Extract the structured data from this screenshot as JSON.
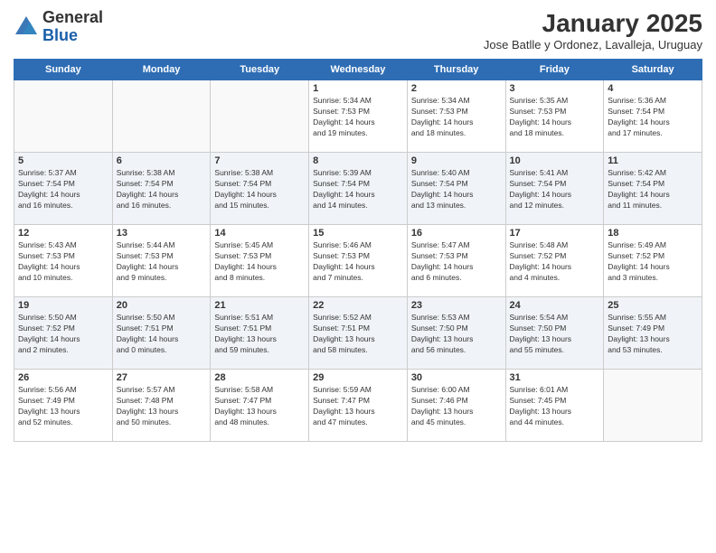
{
  "logo": {
    "general": "General",
    "blue": "Blue"
  },
  "title": "January 2025",
  "location": "Jose Batlle y Ordonez, Lavalleja, Uruguay",
  "days_of_week": [
    "Sunday",
    "Monday",
    "Tuesday",
    "Wednesday",
    "Thursday",
    "Friday",
    "Saturday"
  ],
  "weeks": [
    [
      {
        "num": "",
        "info": ""
      },
      {
        "num": "",
        "info": ""
      },
      {
        "num": "",
        "info": ""
      },
      {
        "num": "1",
        "info": "Sunrise: 5:34 AM\nSunset: 7:53 PM\nDaylight: 14 hours\nand 19 minutes."
      },
      {
        "num": "2",
        "info": "Sunrise: 5:34 AM\nSunset: 7:53 PM\nDaylight: 14 hours\nand 18 minutes."
      },
      {
        "num": "3",
        "info": "Sunrise: 5:35 AM\nSunset: 7:53 PM\nDaylight: 14 hours\nand 18 minutes."
      },
      {
        "num": "4",
        "info": "Sunrise: 5:36 AM\nSunset: 7:54 PM\nDaylight: 14 hours\nand 17 minutes."
      }
    ],
    [
      {
        "num": "5",
        "info": "Sunrise: 5:37 AM\nSunset: 7:54 PM\nDaylight: 14 hours\nand 16 minutes."
      },
      {
        "num": "6",
        "info": "Sunrise: 5:38 AM\nSunset: 7:54 PM\nDaylight: 14 hours\nand 16 minutes."
      },
      {
        "num": "7",
        "info": "Sunrise: 5:38 AM\nSunset: 7:54 PM\nDaylight: 14 hours\nand 15 minutes."
      },
      {
        "num": "8",
        "info": "Sunrise: 5:39 AM\nSunset: 7:54 PM\nDaylight: 14 hours\nand 14 minutes."
      },
      {
        "num": "9",
        "info": "Sunrise: 5:40 AM\nSunset: 7:54 PM\nDaylight: 14 hours\nand 13 minutes."
      },
      {
        "num": "10",
        "info": "Sunrise: 5:41 AM\nSunset: 7:54 PM\nDaylight: 14 hours\nand 12 minutes."
      },
      {
        "num": "11",
        "info": "Sunrise: 5:42 AM\nSunset: 7:54 PM\nDaylight: 14 hours\nand 11 minutes."
      }
    ],
    [
      {
        "num": "12",
        "info": "Sunrise: 5:43 AM\nSunset: 7:53 PM\nDaylight: 14 hours\nand 10 minutes."
      },
      {
        "num": "13",
        "info": "Sunrise: 5:44 AM\nSunset: 7:53 PM\nDaylight: 14 hours\nand 9 minutes."
      },
      {
        "num": "14",
        "info": "Sunrise: 5:45 AM\nSunset: 7:53 PM\nDaylight: 14 hours\nand 8 minutes."
      },
      {
        "num": "15",
        "info": "Sunrise: 5:46 AM\nSunset: 7:53 PM\nDaylight: 14 hours\nand 7 minutes."
      },
      {
        "num": "16",
        "info": "Sunrise: 5:47 AM\nSunset: 7:53 PM\nDaylight: 14 hours\nand 6 minutes."
      },
      {
        "num": "17",
        "info": "Sunrise: 5:48 AM\nSunset: 7:52 PM\nDaylight: 14 hours\nand 4 minutes."
      },
      {
        "num": "18",
        "info": "Sunrise: 5:49 AM\nSunset: 7:52 PM\nDaylight: 14 hours\nand 3 minutes."
      }
    ],
    [
      {
        "num": "19",
        "info": "Sunrise: 5:50 AM\nSunset: 7:52 PM\nDaylight: 14 hours\nand 2 minutes."
      },
      {
        "num": "20",
        "info": "Sunrise: 5:50 AM\nSunset: 7:51 PM\nDaylight: 14 hours\nand 0 minutes."
      },
      {
        "num": "21",
        "info": "Sunrise: 5:51 AM\nSunset: 7:51 PM\nDaylight: 13 hours\nand 59 minutes."
      },
      {
        "num": "22",
        "info": "Sunrise: 5:52 AM\nSunset: 7:51 PM\nDaylight: 13 hours\nand 58 minutes."
      },
      {
        "num": "23",
        "info": "Sunrise: 5:53 AM\nSunset: 7:50 PM\nDaylight: 13 hours\nand 56 minutes."
      },
      {
        "num": "24",
        "info": "Sunrise: 5:54 AM\nSunset: 7:50 PM\nDaylight: 13 hours\nand 55 minutes."
      },
      {
        "num": "25",
        "info": "Sunrise: 5:55 AM\nSunset: 7:49 PM\nDaylight: 13 hours\nand 53 minutes."
      }
    ],
    [
      {
        "num": "26",
        "info": "Sunrise: 5:56 AM\nSunset: 7:49 PM\nDaylight: 13 hours\nand 52 minutes."
      },
      {
        "num": "27",
        "info": "Sunrise: 5:57 AM\nSunset: 7:48 PM\nDaylight: 13 hours\nand 50 minutes."
      },
      {
        "num": "28",
        "info": "Sunrise: 5:58 AM\nSunset: 7:47 PM\nDaylight: 13 hours\nand 48 minutes."
      },
      {
        "num": "29",
        "info": "Sunrise: 5:59 AM\nSunset: 7:47 PM\nDaylight: 13 hours\nand 47 minutes."
      },
      {
        "num": "30",
        "info": "Sunrise: 6:00 AM\nSunset: 7:46 PM\nDaylight: 13 hours\nand 45 minutes."
      },
      {
        "num": "31",
        "info": "Sunrise: 6:01 AM\nSunset: 7:45 PM\nDaylight: 13 hours\nand 44 minutes."
      },
      {
        "num": "",
        "info": ""
      }
    ]
  ]
}
